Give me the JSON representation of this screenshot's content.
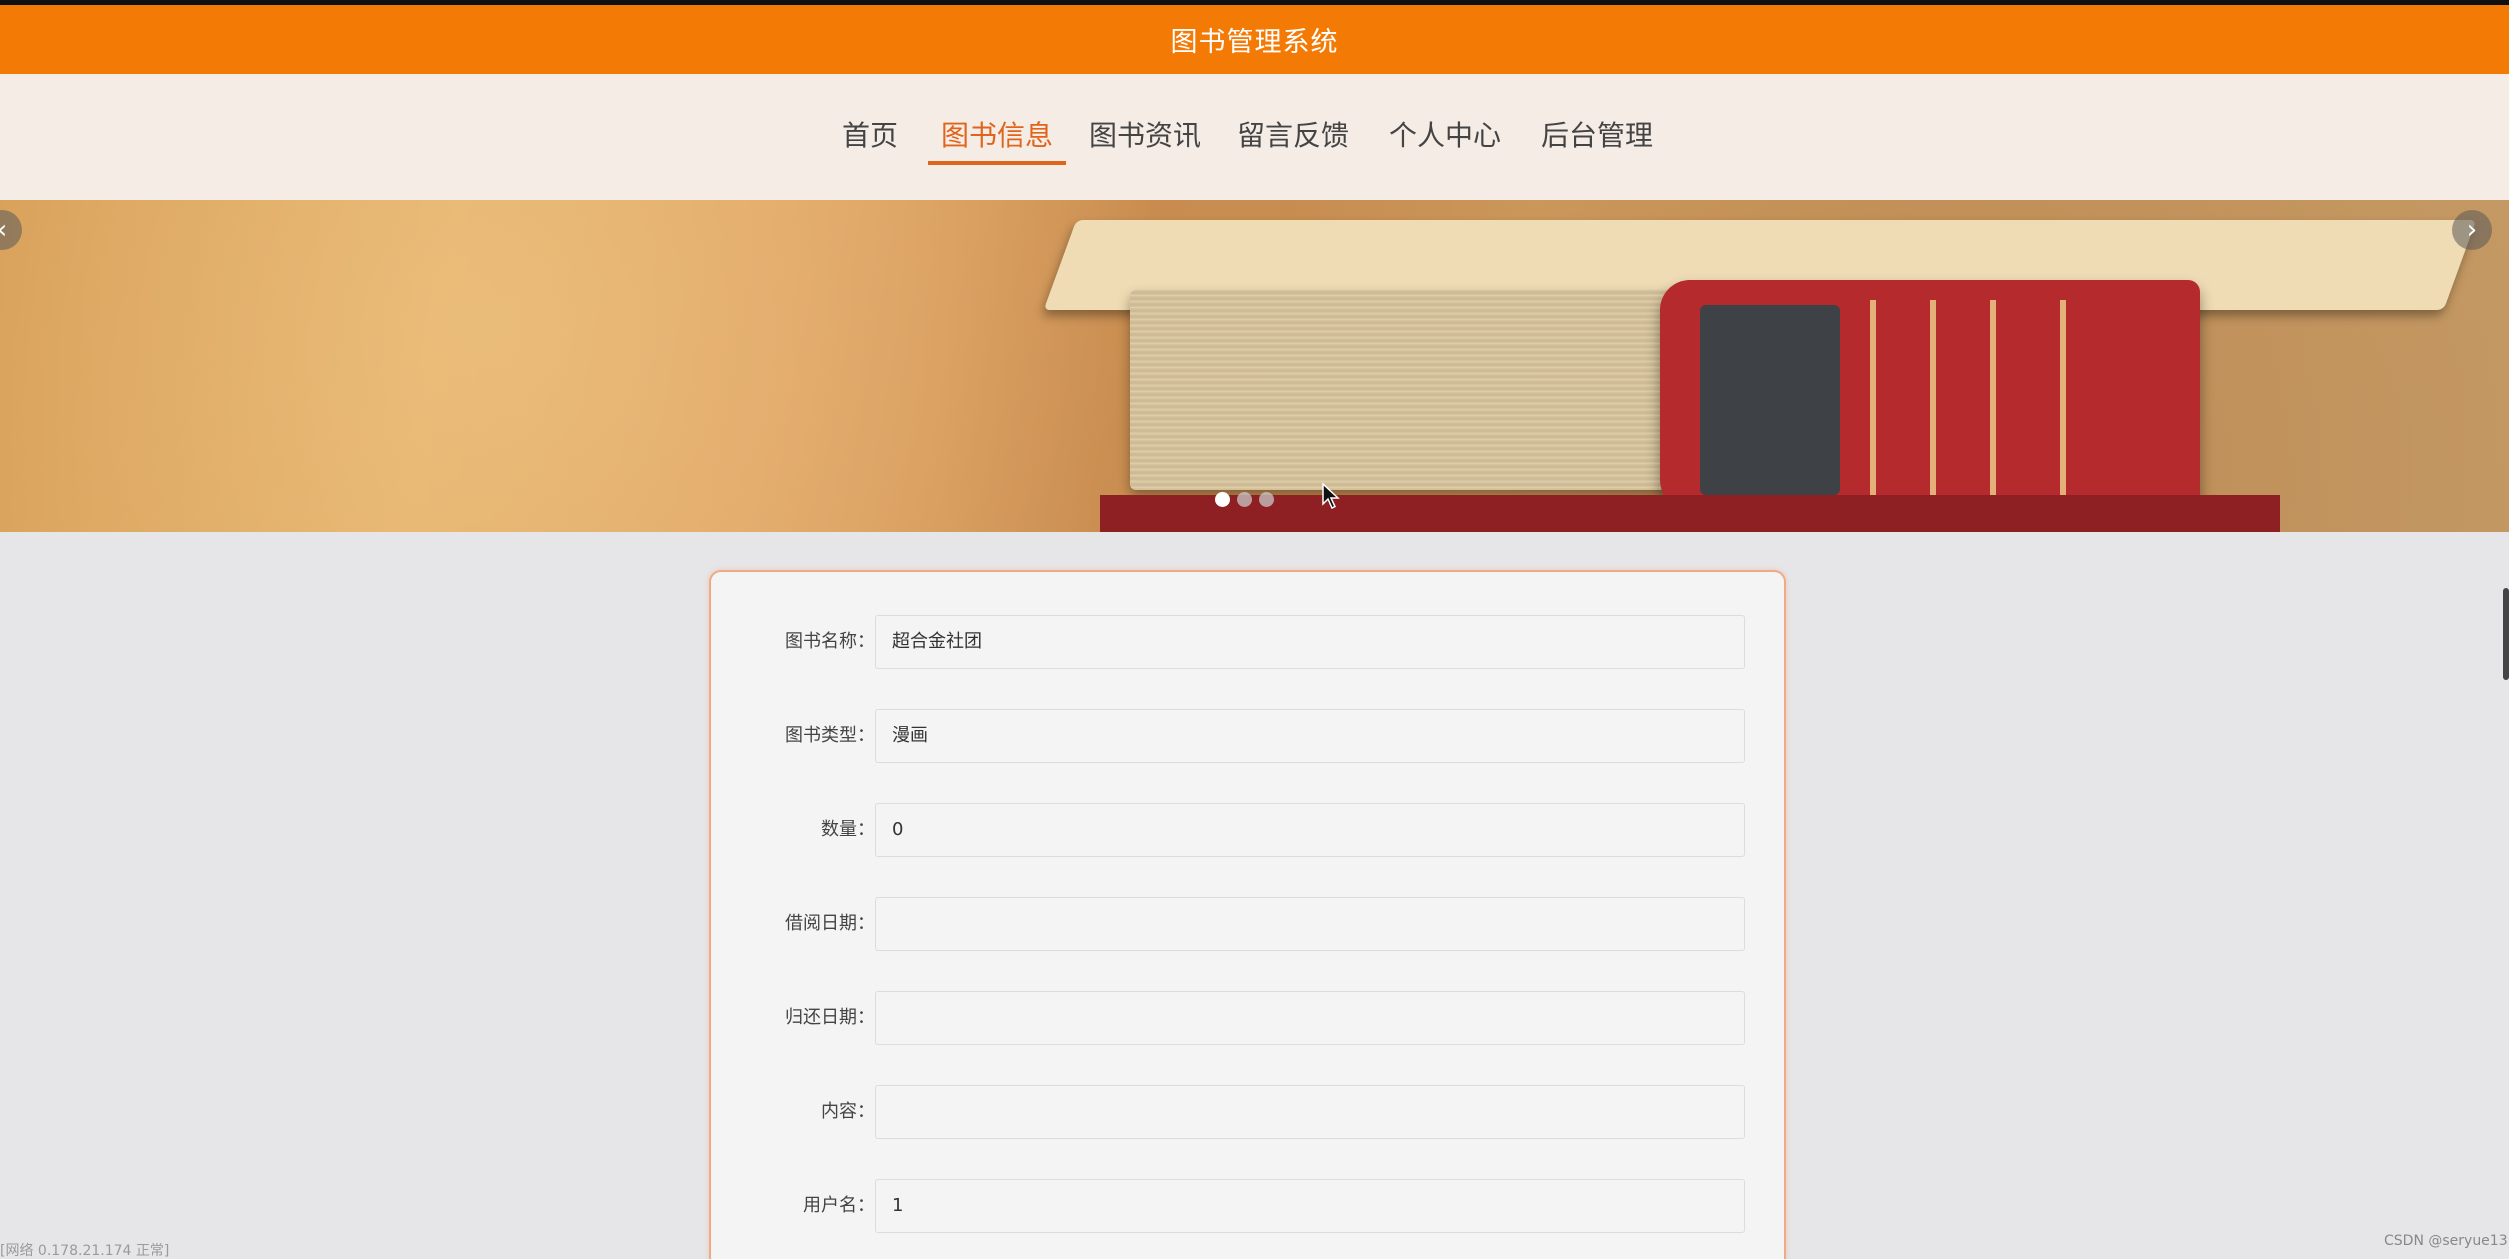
{
  "app": {
    "title": "图书管理系统"
  },
  "nav": {
    "items": [
      {
        "label": "首页"
      },
      {
        "label": "图书信息",
        "active": true
      },
      {
        "label": "图书资讯"
      },
      {
        "label": "留言反馈"
      },
      {
        "label": "个人中心"
      },
      {
        "label": "后台管理"
      }
    ]
  },
  "carousel": {
    "prev_icon": "‹",
    "next_icon": "›",
    "dots": 3,
    "active_dot": 1
  },
  "form": {
    "fields": [
      {
        "label": "图书名称：",
        "value": "超合金社团"
      },
      {
        "label": "图书类型：",
        "value": "漫画"
      },
      {
        "label": "数量：",
        "value": "0"
      },
      {
        "label": "借阅日期：",
        "value": ""
      },
      {
        "label": "归还日期：",
        "value": ""
      },
      {
        "label": "内容：",
        "value": ""
      },
      {
        "label": "用户名：",
        "value": "1"
      }
    ]
  },
  "status": {
    "left": "[网络 0.178.21.174 正常]"
  },
  "watermark": "CSDN @seryue13",
  "colors": {
    "header": "#f47a06",
    "accent": "#e0651c",
    "nav_bg": "#f5ece6",
    "card_border": "#f0a987"
  }
}
